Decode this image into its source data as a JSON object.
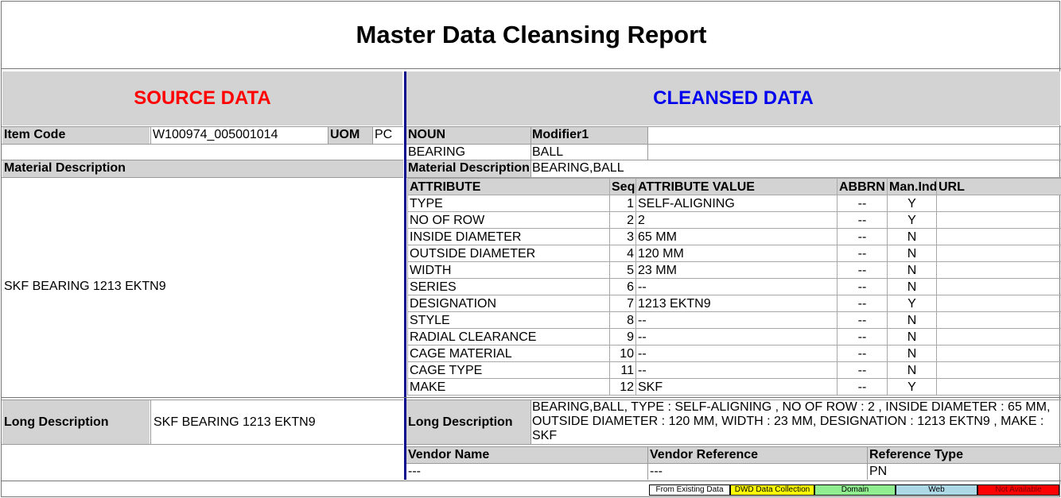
{
  "report_title": "Master Data Cleansing Report",
  "source": {
    "heading": "SOURCE DATA",
    "heading_color": "#ff0000",
    "item_code_label": "Item Code",
    "item_code": "W100974_005001014",
    "uom_label": "UOM",
    "uom": "PC",
    "material_desc_label": "Material Description",
    "material_desc": "SKF BEARING 1213 EKTN9",
    "long_desc_label": "Long Description",
    "long_desc": "SKF BEARING 1213 EKTN9"
  },
  "cleansed": {
    "heading": "CLEANSED DATA",
    "heading_color": "#0000ee",
    "noun_label": "NOUN",
    "modifier_label": "Modifier1",
    "noun": "BEARING",
    "modifier": "BALL",
    "material_desc_label": "Material Description",
    "material_desc": "BEARING,BALL",
    "attr_headers": {
      "attribute": "ATTRIBUTE",
      "seq": "Seq",
      "value": "ATTRIBUTE VALUE",
      "abbrn": "ABBRN",
      "manind": "Man.Ind",
      "url": "URL"
    },
    "attributes": [
      {
        "name": "TYPE",
        "seq": "1",
        "value": "SELF-ALIGNING",
        "abbrn": "--",
        "manind": "Y",
        "url": ""
      },
      {
        "name": "NO OF ROW",
        "seq": "2",
        "value": "2",
        "abbrn": "--",
        "manind": "Y",
        "url": ""
      },
      {
        "name": "INSIDE DIAMETER",
        "seq": "3",
        "value": "65 MM",
        "abbrn": "--",
        "manind": "N",
        "url": ""
      },
      {
        "name": "OUTSIDE DIAMETER",
        "seq": "4",
        "value": "120 MM",
        "abbrn": "--",
        "manind": "N",
        "url": ""
      },
      {
        "name": "WIDTH",
        "seq": "5",
        "value": "23 MM",
        "abbrn": "--",
        "manind": "N",
        "url": ""
      },
      {
        "name": "SERIES",
        "seq": "6",
        "value": "--",
        "abbrn": "--",
        "manind": "N",
        "url": ""
      },
      {
        "name": "DESIGNATION",
        "seq": "7",
        "value": "1213 EKTN9",
        "abbrn": "--",
        "manind": "Y",
        "url": ""
      },
      {
        "name": "STYLE",
        "seq": "8",
        "value": "--",
        "abbrn": "--",
        "manind": "N",
        "url": ""
      },
      {
        "name": "RADIAL CLEARANCE",
        "seq": "9",
        "value": "--",
        "abbrn": "--",
        "manind": "N",
        "url": ""
      },
      {
        "name": "CAGE MATERIAL",
        "seq": "10",
        "value": "--",
        "abbrn": "--",
        "manind": "N",
        "url": ""
      },
      {
        "name": "CAGE TYPE",
        "seq": "11",
        "value": "--",
        "abbrn": "--",
        "manind": "N",
        "url": ""
      },
      {
        "name": "MAKE",
        "seq": "12",
        "value": "SKF",
        "abbrn": "--",
        "manind": "Y",
        "url": ""
      }
    ],
    "long_desc_label": "Long Description",
    "long_desc": "BEARING,BALL, TYPE : SELF-ALIGNING , NO OF ROW : 2 , INSIDE DIAMETER : 65 MM, OUTSIDE DIAMETER : 120 MM, WIDTH : 23 MM, DESIGNATION : 1213 EKTN9 , MAKE : SKF",
    "vendor_name_label": "Vendor Name",
    "vendor_reference_label": "Vendor Reference",
    "reference_type_label": "Reference Type",
    "vendor_name": "---",
    "vendor_reference": "---",
    "reference_type": "PN"
  },
  "legend": [
    {
      "label": "From Existing Data",
      "color": "#ffffff"
    },
    {
      "label": "DWD Data Collection",
      "color": "#ffff00"
    },
    {
      "label": "Domain",
      "color": "#90ee90"
    },
    {
      "label": "Web",
      "color": "#add8e6"
    },
    {
      "label": "Not Available",
      "color": "#ff0000"
    }
  ]
}
